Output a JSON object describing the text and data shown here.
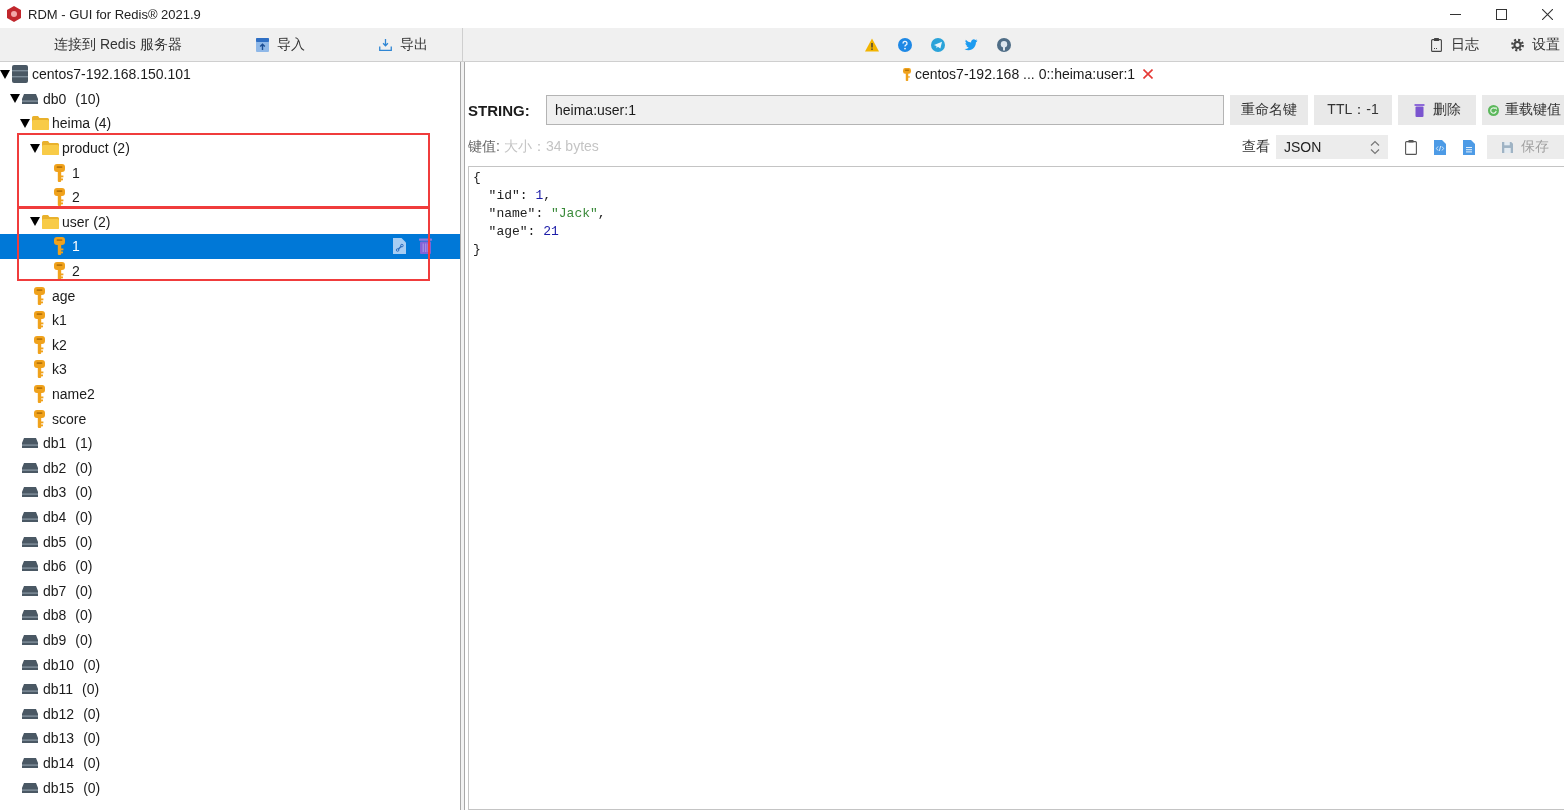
{
  "window": {
    "title": "RDM - GUI for Redis® 2021.9"
  },
  "toolbar": {
    "connect_button": "连接到 Redis 服务器",
    "import_button": "导入",
    "export_button": "导出",
    "log_button": "日志",
    "settings_button": "设置"
  },
  "tree": [
    {
      "kind": "server",
      "name": "centos7-192.168.150.101",
      "expanded": true,
      "selected": false,
      "children": [
        {
          "kind": "db",
          "name": "db0",
          "count": "(10)",
          "expanded": true,
          "selected": false,
          "children": [
            {
              "kind": "folder",
              "name": "heima",
              "count": "(4)",
              "expanded": true,
              "selected": false,
              "highlighted": false,
              "children": [
                {
                  "kind": "folder",
                  "name": "product",
                  "count": "(2)",
                  "expanded": true,
                  "selected": false,
                  "highlighted": true,
                  "children": [
                    {
                      "kind": "key",
                      "name": "1",
                      "selected": false
                    },
                    {
                      "kind": "key",
                      "name": "2",
                      "selected": false
                    }
                  ]
                },
                {
                  "kind": "folder",
                  "name": "user",
                  "count": "(2)",
                  "expanded": true,
                  "selected": false,
                  "highlighted": true,
                  "children": [
                    {
                      "kind": "key",
                      "name": "1",
                      "selected": true
                    },
                    {
                      "kind": "key",
                      "name": "2",
                      "selected": false
                    }
                  ]
                }
              ]
            },
            {
              "kind": "key",
              "name": "age",
              "selected": false
            },
            {
              "kind": "key",
              "name": "k1",
              "selected": false
            },
            {
              "kind": "key",
              "name": "k2",
              "selected": false
            },
            {
              "kind": "key",
              "name": "k3",
              "selected": false
            },
            {
              "kind": "key",
              "name": "name2",
              "selected": false
            },
            {
              "kind": "key",
              "name": "score",
              "selected": false
            }
          ]
        },
        {
          "kind": "db",
          "name": "db1",
          "count": "(1)",
          "expanded": false,
          "selected": false
        },
        {
          "kind": "db",
          "name": "db2",
          "count": "(0)",
          "expanded": false,
          "selected": false
        },
        {
          "kind": "db",
          "name": "db3",
          "count": "(0)",
          "expanded": false,
          "selected": false
        },
        {
          "kind": "db",
          "name": "db4",
          "count": "(0)",
          "expanded": false,
          "selected": false
        },
        {
          "kind": "db",
          "name": "db5",
          "count": "(0)",
          "expanded": false,
          "selected": false
        },
        {
          "kind": "db",
          "name": "db6",
          "count": "(0)",
          "expanded": false,
          "selected": false
        },
        {
          "kind": "db",
          "name": "db7",
          "count": "(0)",
          "expanded": false,
          "selected": false
        },
        {
          "kind": "db",
          "name": "db8",
          "count": "(0)",
          "expanded": false,
          "selected": false
        },
        {
          "kind": "db",
          "name": "db9",
          "count": "(0)",
          "expanded": false,
          "selected": false
        },
        {
          "kind": "db",
          "name": "db10",
          "count": "(0)",
          "expanded": false,
          "selected": false
        },
        {
          "kind": "db",
          "name": "db11",
          "count": "(0)",
          "expanded": false,
          "selected": false
        },
        {
          "kind": "db",
          "name": "db12",
          "count": "(0)",
          "expanded": false,
          "selected": false
        },
        {
          "kind": "db",
          "name": "db13",
          "count": "(0)",
          "expanded": false,
          "selected": false
        },
        {
          "kind": "db",
          "name": "db14",
          "count": "(0)",
          "expanded": false,
          "selected": false
        },
        {
          "kind": "db",
          "name": "db15",
          "count": "(0)",
          "expanded": false,
          "selected": false
        }
      ]
    }
  ],
  "key_tab": {
    "title": "centos7-192.168 ... 0::heima:user:1"
  },
  "key_view": {
    "type_label": "STRING:",
    "key_name": "heima:user:1",
    "rename_button": "重命名键",
    "ttl_button": "TTL：-1",
    "delete_button": "删除",
    "reload_button": "重载键值",
    "value_label": "键值:",
    "size_label": "大小：34 bytes",
    "view_label": "查看",
    "view_format": "JSON",
    "save_button": {
      "label": "保存",
      "disabled": true
    }
  },
  "editor": {
    "lines": [
      {
        "tokens": [
          {
            "kind": "plain",
            "text": "{"
          }
        ]
      },
      {
        "tokens": [
          {
            "kind": "plain",
            "text": "  \"id\": "
          },
          {
            "kind": "number",
            "text": "1"
          },
          {
            "kind": "plain",
            "text": ","
          }
        ]
      },
      {
        "tokens": [
          {
            "kind": "plain",
            "text": "  \"name\": "
          },
          {
            "kind": "string",
            "text": "\"Jack\""
          },
          {
            "kind": "plain",
            "text": ","
          }
        ]
      },
      {
        "tokens": [
          {
            "kind": "plain",
            "text": "  \"age\": "
          },
          {
            "kind": "number",
            "text": "21"
          }
        ]
      },
      {
        "tokens": [
          {
            "kind": "plain",
            "text": "}"
          }
        ]
      }
    ]
  }
}
